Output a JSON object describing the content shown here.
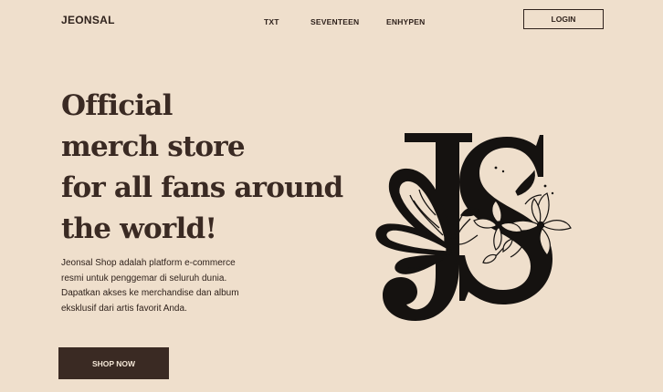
{
  "header": {
    "brand": "JEONSAL",
    "nav": [
      "TXT",
      "SEVENTEEN",
      "ENHYPEN"
    ],
    "login_label": "LOGIN"
  },
  "hero": {
    "title_lines": [
      "Official",
      "merch store",
      "for all fans around",
      "the world!"
    ],
    "description_lines": [
      "Jeonsal Shop adalah platform e-commerce",
      "resmi untuk penggemar di seluruh dunia.",
      "Dapatkan akses ke merchandise dan album",
      "eksklusif dari artis favorit Anda."
    ],
    "cta_label": "SHOP NOW"
  },
  "logo": {
    "monogram": "JS",
    "ink_color": "#151210",
    "background_color": "#efdfcc"
  }
}
